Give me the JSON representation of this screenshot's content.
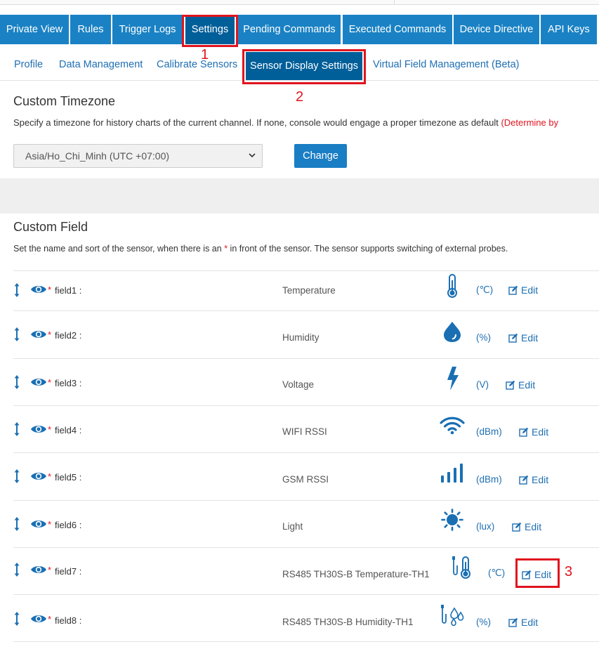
{
  "tabs": [
    {
      "label": "Private View"
    },
    {
      "label": "Rules"
    },
    {
      "label": "Trigger Logs"
    },
    {
      "label": "Settings"
    },
    {
      "label": "Pending Commands"
    },
    {
      "label": "Executed Commands"
    },
    {
      "label": "Device Directive"
    },
    {
      "label": "API Keys"
    }
  ],
  "subtabs": [
    {
      "label": "Profile"
    },
    {
      "label": "Data Management"
    },
    {
      "label": "Calibrate Sensors"
    },
    {
      "label": "Sensor Display Settings"
    },
    {
      "label": "Virtual Field Management (Beta)"
    }
  ],
  "annotations": {
    "one": "1",
    "two": "2",
    "three": "3"
  },
  "timezone": {
    "title": "Custom Timezone",
    "description": "Specify a timezone for history charts of the current channel. If none, console would engage a proper timezone as default ",
    "description_note": "(Determine by",
    "selected": "Asia/Ho_Chi_Minh (UTC +07:00)",
    "change_label": "Change"
  },
  "custom_field": {
    "title": "Custom Field",
    "desc_before": "Set the name and sort of the sensor, when there is an ",
    "desc_star": "*",
    "desc_after": " in front of the sensor. The sensor supports switching of external probes.",
    "star": "*",
    "edit_label": "Edit",
    "fields": [
      {
        "field": "field1 :",
        "sensor": "Temperature",
        "unit": "(℃)",
        "icon": "thermometer-icon"
      },
      {
        "field": "field2 :",
        "sensor": "Humidity",
        "unit": "(%)",
        "icon": "water-drop-icon"
      },
      {
        "field": "field3 :",
        "sensor": "Voltage",
        "unit": "(V)",
        "icon": "lightning-icon"
      },
      {
        "field": "field4 :",
        "sensor": "WIFI RSSI",
        "unit": "(dBm)",
        "icon": "wifi-icon"
      },
      {
        "field": "field5 :",
        "sensor": "GSM RSSI",
        "unit": "(dBm)",
        "icon": "signal-bars-icon"
      },
      {
        "field": "field6 :",
        "sensor": "Light",
        "unit": "(lux)",
        "icon": "sun-icon"
      },
      {
        "field": "field7 :",
        "sensor": "RS485 TH30S-B Temperature-TH1",
        "unit": "(℃)",
        "icon": "probe-thermometer-icon"
      },
      {
        "field": "field8 :",
        "sensor": "RS485 TH30S-B Humidity-TH1",
        "unit": "(%)",
        "icon": "probe-humidity-icon"
      }
    ]
  },
  "colors": {
    "accent": "#1a82c4",
    "active": "#005e99",
    "highlight": "#e0141e",
    "link": "#1f6fb2"
  }
}
